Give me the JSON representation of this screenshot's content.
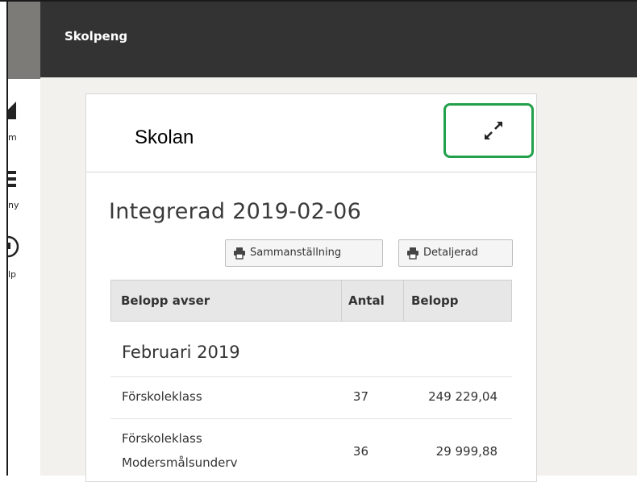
{
  "sidenav": {
    "items": [
      {
        "icon": "home-icon",
        "label": "m"
      },
      {
        "icon": "menu-icon",
        "label": "ny"
      },
      {
        "icon": "help-icon",
        "label": "lp"
      }
    ]
  },
  "header": {
    "title": "Skolpeng"
  },
  "card": {
    "title": "Skolan",
    "expand_icon": "expand-icon",
    "report_title": "Integrerad 2019-02-06",
    "buttons": {
      "summary": "Sammanställning",
      "detailed": "Detaljerad"
    },
    "table": {
      "columns": [
        "Belopp avser",
        "Antal",
        "Belopp"
      ],
      "group": "Februari 2019",
      "rows": [
        {
          "label": "Förskoleklass",
          "label2": "",
          "antal": "37",
          "belopp": "249 229,04"
        },
        {
          "label": "Förskoleklass",
          "label2": "Modersmålsunderv",
          "antal": "36",
          "belopp": "29 999,88"
        }
      ]
    }
  },
  "colors": {
    "header_bg": "#333333",
    "highlight": "#22a04a",
    "content_bg": "#f2f1ee"
  }
}
